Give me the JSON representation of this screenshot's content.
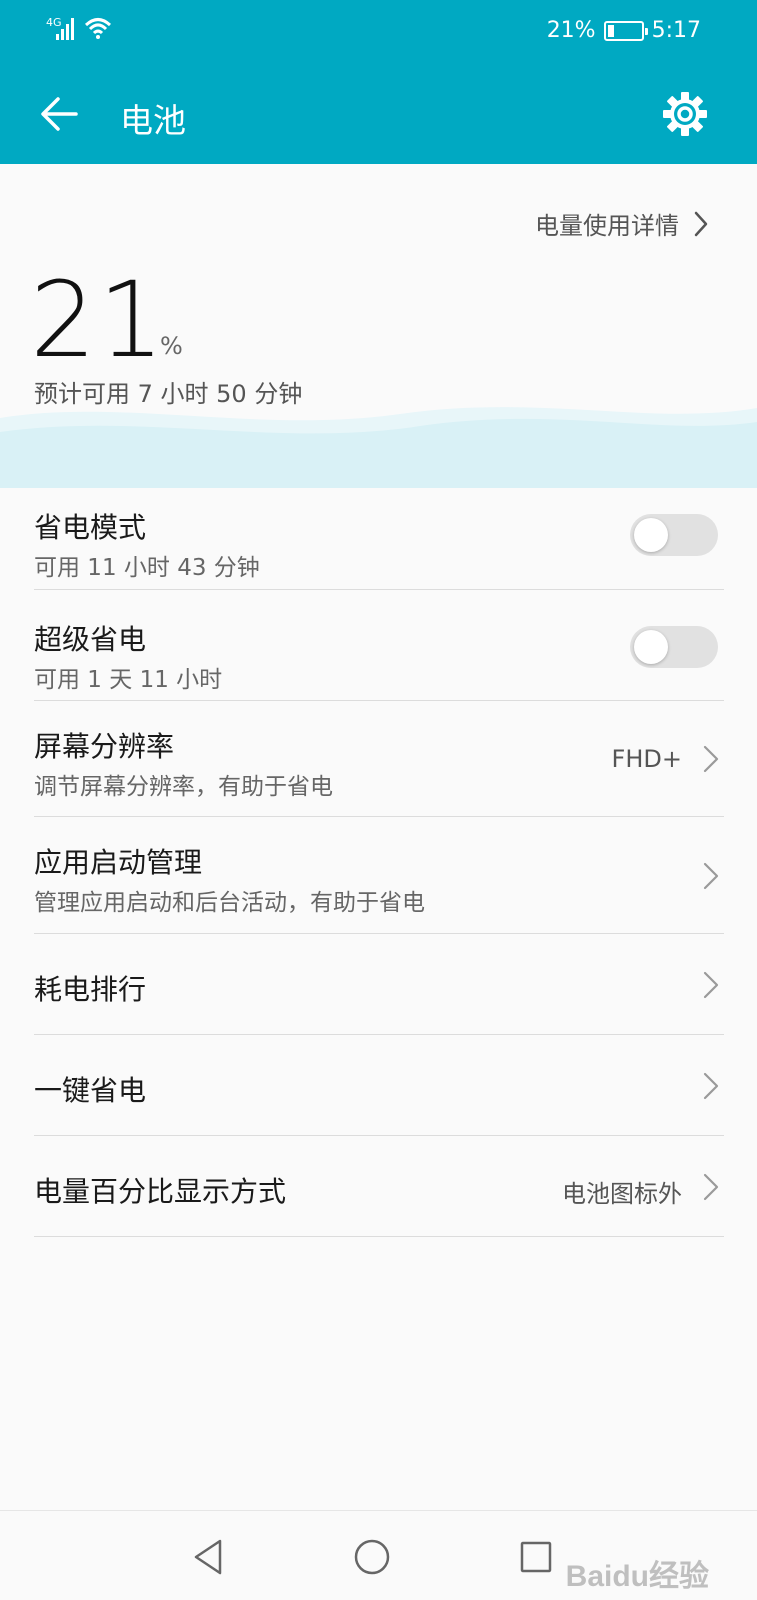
{
  "status_bar": {
    "network": "4G",
    "battery_text": "21%",
    "battery_level": 0.21,
    "time": "5:17"
  },
  "app_bar": {
    "title": "电池",
    "back_icon": "arrow-left-icon",
    "settings_icon": "gear-icon"
  },
  "summary": {
    "detail_link": "电量使用详情",
    "percent": "21",
    "percent_sign": "%",
    "estimate": "预计可用 7 小时 50 分钟"
  },
  "items": [
    {
      "title": "省电模式",
      "subtitle": "可用 11 小时 43 分钟",
      "toggle_on": false
    },
    {
      "title": "超级省电",
      "subtitle": "可用 1 天 11 小时",
      "toggle_on": false
    },
    {
      "title": "屏幕分辨率",
      "subtitle": "调节屏幕分辨率，有助于省电",
      "value": "FHD+"
    },
    {
      "title": "应用启动管理",
      "subtitle": "管理应用启动和后台活动，有助于省电"
    },
    {
      "title": "耗电排行"
    },
    {
      "title": "一键省电"
    },
    {
      "title": "电量百分比显示方式",
      "value": "电池图标外"
    }
  ],
  "nav_bar": {
    "back_icon": "triangle-back-icon",
    "home_icon": "circle-home-icon",
    "recents_icon": "square-recents-icon"
  },
  "watermark": "Baidu经验",
  "colors": {
    "accent": "#00a9c2",
    "wave": "#d9f1f6"
  }
}
